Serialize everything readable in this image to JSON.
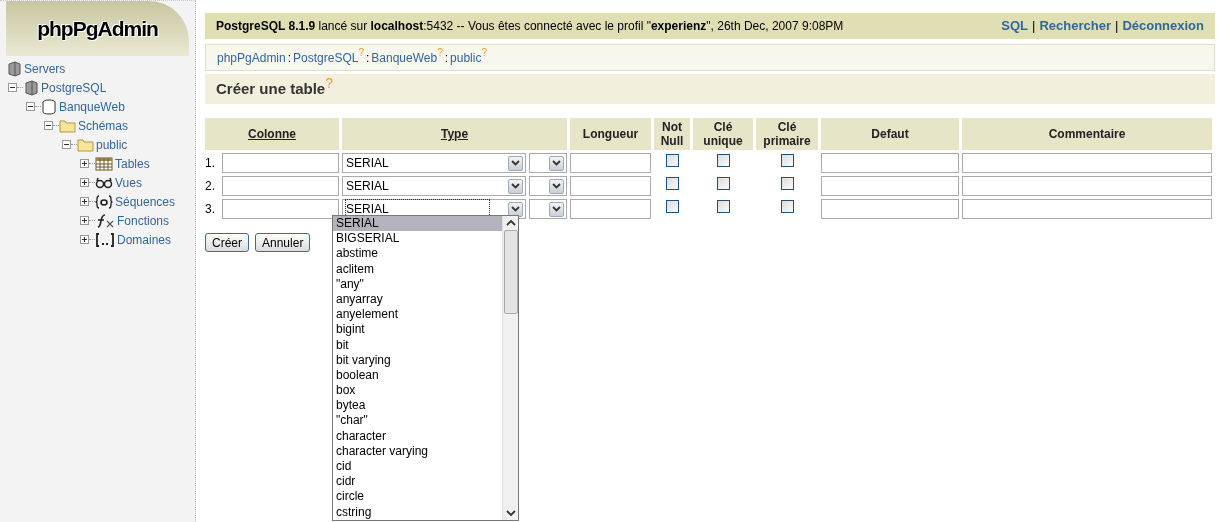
{
  "logo": "phpPgAdmin",
  "tree": [
    {
      "label": "Servers",
      "kind": "server",
      "children": [
        {
          "label": "PostgreSQL",
          "kind": "server",
          "expanded": true,
          "children": [
            {
              "label": "BanqueWeb",
              "kind": "database",
              "expanded": true,
              "children": [
                {
                  "label": "Schémas",
                  "kind": "folder",
                  "expanded": true,
                  "children": [
                    {
                      "label": "public",
                      "kind": "folder",
                      "expanded": true,
                      "children": [
                        {
                          "label": "Tables",
                          "kind": "table",
                          "expanded": false
                        },
                        {
                          "label": "Vues",
                          "kind": "glasses",
                          "expanded": false
                        },
                        {
                          "label": "Séquences",
                          "kind": "sequence",
                          "expanded": false
                        },
                        {
                          "label": "Fonctions",
                          "kind": "function",
                          "expanded": false
                        },
                        {
                          "label": "Domaines",
                          "kind": "domain",
                          "expanded": false
                        }
                      ]
                    }
                  ]
                }
              ]
            }
          ]
        }
      ]
    }
  ],
  "header": {
    "info": "**PostgreSQL 8.1.9** lancé sur **localhost**:5432 -- Vous êtes connecté avec le profil \"**experienz**\", 26th Dec, 2007 9:08PM",
    "links": [
      "SQL",
      "Rechercher",
      "Déconnexion"
    ],
    "separator": "|"
  },
  "breadcrumb": [
    {
      "label": "phpPgAdmin"
    },
    {
      "label": "PostgreSQL",
      "help": "?"
    },
    {
      "label": "BanqueWeb",
      "help": "?"
    },
    {
      "label": "public",
      "help": "?"
    }
  ],
  "breadcrumb_separator": ":",
  "page_title": {
    "text": "Créer une table",
    "help": "?"
  },
  "columns": [
    {
      "label": "Colonne",
      "kind": "link"
    },
    {
      "label": "Type",
      "kind": "link"
    },
    {
      "label": "Longueur",
      "kind": "plain"
    },
    {
      "label": "Not Null",
      "kind": "plain"
    },
    {
      "label": "Clé unique",
      "kind": "plain"
    },
    {
      "label": "Clé primaire",
      "kind": "plain"
    },
    {
      "label": "Defaut",
      "kind": "plain"
    },
    {
      "label": "Commentaire",
      "kind": "plain"
    }
  ],
  "rows": [
    {
      "number": "1.",
      "type": "SERIAL",
      "focused": false,
      "not_null": false,
      "unique": false,
      "primary": false
    },
    {
      "number": "2.",
      "type": "SERIAL",
      "focused": false,
      "not_null": false,
      "unique": false,
      "primary": false
    },
    {
      "number": "3.",
      "type": "SERIAL",
      "focused": true,
      "not_null": false,
      "unique": false,
      "primary": false
    }
  ],
  "buttons": [
    "Créer",
    "Annuler"
  ],
  "dropdown_options": [
    {
      "label": "SERIAL",
      "selected": true
    },
    {
      "label": "BIGSERIAL",
      "selected": false
    },
    {
      "label": "abstime",
      "selected": false
    },
    {
      "label": "aclitem",
      "selected": false
    },
    {
      "label": "\"any\"",
      "selected": false
    },
    {
      "label": "anyarray",
      "selected": false
    },
    {
      "label": "anyelement",
      "selected": false
    },
    {
      "label": "bigint",
      "selected": false
    },
    {
      "label": "bit",
      "selected": false
    },
    {
      "label": "bit varying",
      "selected": false
    },
    {
      "label": "boolean",
      "selected": false
    },
    {
      "label": "box",
      "selected": false
    },
    {
      "label": "bytea",
      "selected": false
    },
    {
      "label": "\"char\"",
      "selected": false
    },
    {
      "label": "character",
      "selected": false
    },
    {
      "label": "character varying",
      "selected": false
    },
    {
      "label": "cid",
      "selected": false
    },
    {
      "label": "cidr",
      "selected": false
    },
    {
      "label": "circle",
      "selected": false
    },
    {
      "label": "cstring",
      "selected": false
    }
  ]
}
